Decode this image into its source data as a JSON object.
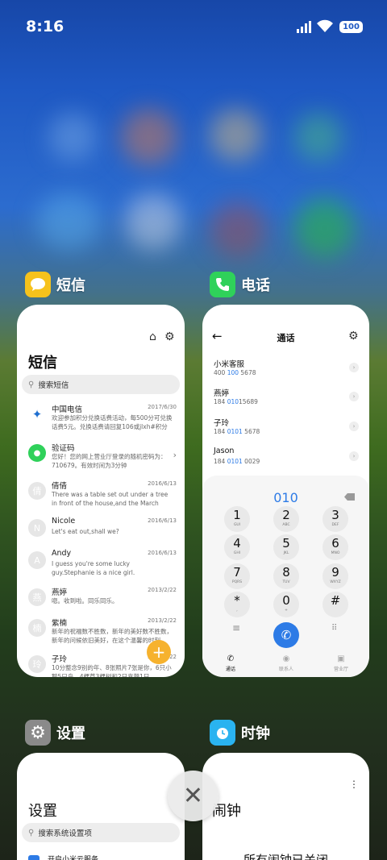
{
  "status_bar": {
    "time": "8:16",
    "battery": "100"
  },
  "cards": {
    "sms": {
      "app_name": "短信",
      "title": "短信",
      "search_placeholder": "搜索短信",
      "messages": [
        {
          "name": "中国电信",
          "date": "2017/6/30",
          "preview": "欢迎参加积分兑换话费活动，每500分可兑换话费5元。兑换话费请回复106或jlxh#积分",
          "avatar": "telecom-logo"
        },
        {
          "name": "验证码",
          "date": "",
          "preview": "您好！您的网上营业厅登录的随机密码为：710679。有效时间为3分钟",
          "avatar": "message-logo"
        },
        {
          "name": "倩倩",
          "date": "2016/6/13",
          "preview": "There was a table set out under a tree in front of the house,and the March Hare and",
          "avatar": "倩"
        },
        {
          "name": "Nicole",
          "date": "2016/6/13",
          "preview": "Let's eat out,shall we?",
          "avatar": "N"
        },
        {
          "name": "Andy",
          "date": "2016/6/13",
          "preview": "I guess you're some lucky guy.Stephanie is a nice girl.",
          "avatar": "A"
        },
        {
          "name": "燕婷",
          "date": "2013/2/22",
          "preview": "唿。收到啦。同乐同乐。",
          "avatar": "燕"
        },
        {
          "name": "紫楠",
          "date": "2013/2/22",
          "preview": "新年的祝福数不胜数，新年的美好数不胜数，新年的问候依旧美好，在这个温馨的时刻",
          "avatar": "楠"
        },
        {
          "name": "子玲",
          "date": "2013/2/22",
          "preview": "10分整念9别的年、8张照片7张是你，6只小鹅5只鸟、4棵草3棵树和2只喜鹊1只",
          "avatar": "玲"
        }
      ],
      "fab": "+"
    },
    "phone": {
      "app_name": "电话",
      "title": "通话",
      "contacts": [
        {
          "name": "小米客服",
          "num_a": "400 ",
          "num_b": "100",
          "num_c": " 5678"
        },
        {
          "name": "燕婷",
          "num_a": "184 ",
          "num_b": "010",
          "num_c": "15689"
        },
        {
          "name": "子玲",
          "num_a": "184 ",
          "num_b": "0101",
          "num_c": " 5678"
        },
        {
          "name": "Jason",
          "num_a": "184 ",
          "num_b": "0101",
          "num_c": " 0029"
        }
      ],
      "dial_input": "010",
      "keys": [
        {
          "d": "1",
          "l": "GUI"
        },
        {
          "d": "2",
          "l": "ABC"
        },
        {
          "d": "3",
          "l": "DEF"
        },
        {
          "d": "4",
          "l": "GHI"
        },
        {
          "d": "5",
          "l": "JKL"
        },
        {
          "d": "6",
          "l": "MNO"
        },
        {
          "d": "7",
          "l": "PQRS"
        },
        {
          "d": "8",
          "l": "TUV"
        },
        {
          "d": "9",
          "l": "WXYZ"
        },
        {
          "d": "*",
          "l": ","
        },
        {
          "d": "0",
          "l": "+"
        },
        {
          "d": "#",
          "l": ""
        }
      ],
      "tabs": [
        "通话",
        "联系人",
        "营业厅"
      ]
    },
    "settings": {
      "app_name": "设置",
      "title": "设置",
      "search_placeholder": "搜索系统设置项",
      "first_item": "开启小米云服务"
    },
    "clock": {
      "app_name": "时钟",
      "title": "闹钟",
      "empty_text": "所有闹钟已关闭"
    }
  },
  "colors": {
    "sms_icon": "#f6c21c",
    "phone_icon": "#2fd15a",
    "settings_icon": "#8a8a8a",
    "clock_icon": "#2ab3f0",
    "accent": "#2d7be6",
    "fab": "#f6b22e"
  }
}
